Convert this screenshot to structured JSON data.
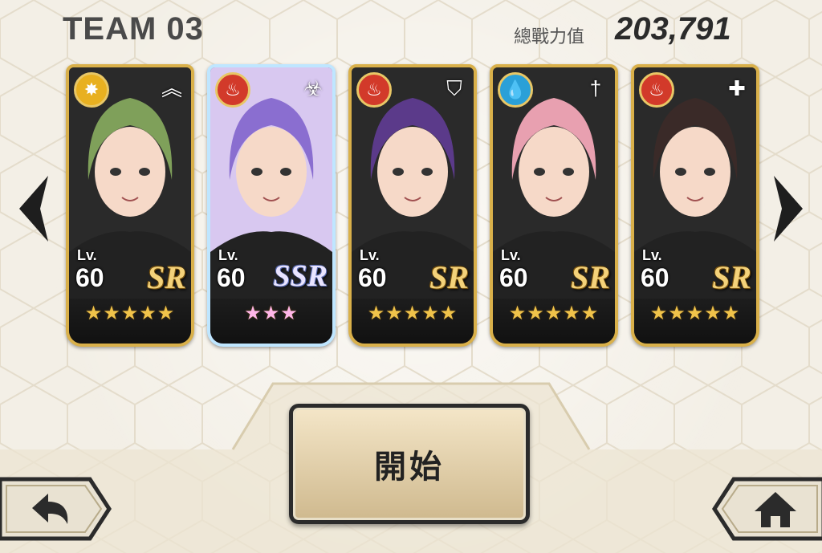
{
  "header": {
    "team_title": "TEAM 03",
    "power_label": "總戰力值",
    "power_value": "203,791"
  },
  "cards": [
    {
      "element": "light",
      "element_color": "#e8b020",
      "role_icon": "chevron-up-icon",
      "level_label": "Lv.",
      "level": "60",
      "rarity": "SR",
      "stars": "★★★★★",
      "hair_color": "#7fa05a"
    },
    {
      "element": "fire",
      "element_color": "#d23a2a",
      "role_icon": "biohazard-icon",
      "level_label": "Lv.",
      "level": "60",
      "rarity": "SSR",
      "stars": "★★★",
      "hair_color": "#8a6ed0"
    },
    {
      "element": "fire",
      "element_color": "#d23a2a",
      "role_icon": "shield-icon",
      "level_label": "Lv.",
      "level": "60",
      "rarity": "SR",
      "stars": "★★★★★",
      "hair_color": "#5b3a8a"
    },
    {
      "element": "water",
      "element_color": "#2aa0d8",
      "role_icon": "sword-icon",
      "level_label": "Lv.",
      "level": "60",
      "rarity": "SR",
      "stars": "★★★★★",
      "hair_color": "#e8a0b0"
    },
    {
      "element": "fire",
      "element_color": "#d23a2a",
      "role_icon": "cross-icon",
      "level_label": "Lv.",
      "level": "60",
      "rarity": "SR",
      "stars": "★★★★★",
      "hair_color": "#3a2a28"
    }
  ],
  "start_button": {
    "label": "開始"
  },
  "colors": {
    "card_gold": "#d9b04a",
    "background": "#f3efe6",
    "button_fill": "#e6d3ad"
  }
}
